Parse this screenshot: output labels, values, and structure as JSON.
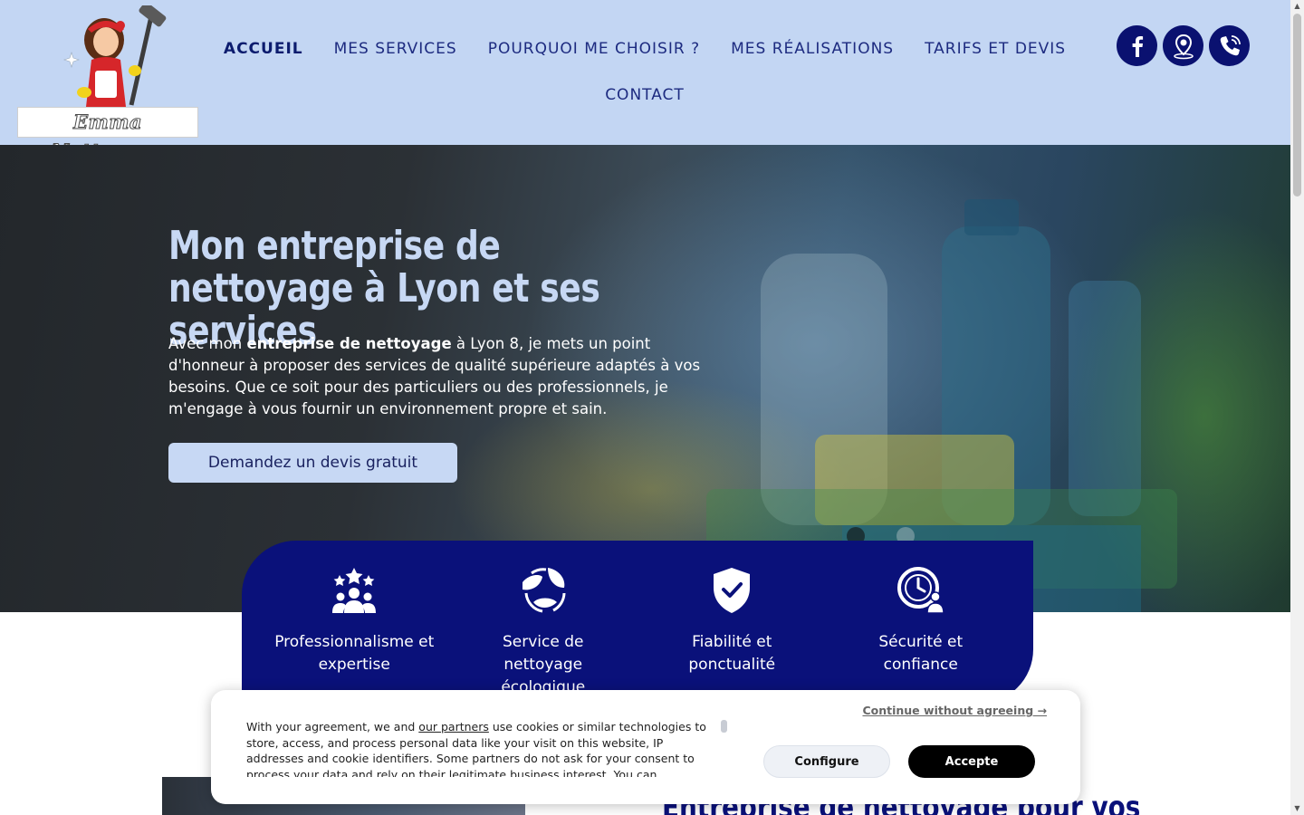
{
  "header": {
    "logo_text": "Emma Nettoyage",
    "nav": {
      "items": [
        {
          "label": "ACCUEIL",
          "active": true
        },
        {
          "label": "MES SERVICES"
        },
        {
          "label": "POURQUOI ME CHOISIR ?"
        },
        {
          "label": "MES RÉALISATIONS"
        },
        {
          "label": "TARIFS ET DEVIS"
        },
        {
          "label": "CONTACT"
        }
      ]
    },
    "socials": [
      {
        "icon": "facebook-icon"
      },
      {
        "icon": "map-pin-icon"
      },
      {
        "icon": "phone-icon"
      }
    ]
  },
  "hero": {
    "title": "Mon entreprise de nettoyage à Lyon et ses services",
    "text_before": "Avec mon ",
    "text_bold": "entreprise de nettoyage",
    "text_after": " à Lyon 8, je mets un point d'honneur à proposer des services de qualité supérieure adaptés à vos besoins. Que ce soit pour des particuliers ou des professionnels, je m'engage à vous fournir un environnement propre et sain.",
    "cta_label": "Demandez un devis gratuit"
  },
  "features": [
    {
      "icon": "team-stars-icon",
      "label": "Professionnalisme et expertise"
    },
    {
      "icon": "eco-leaf-icon",
      "label": "Service de nettoyage écologique"
    },
    {
      "icon": "shield-check-icon",
      "label": "Fiabilité et ponctualité"
    },
    {
      "icon": "clock-user-icon",
      "label": "Sécurité et confiance"
    }
  ],
  "lower": {
    "title": "Entreprise de nettoyage pour vos"
  },
  "cookie": {
    "text_before": "With your agreement, we and ",
    "link": "our partners",
    "text_after": " use cookies or similar technologies to store, access, and process personal data like your visit on this website, IP addresses and cookie identifiers. Some partners do not ask for your consent to process your data and rely on their legitimate business interest. You can",
    "continue": "Continue without agreeing →",
    "configure": "Configure",
    "accept": "Accepte"
  },
  "colors": {
    "header_bg": "#c3d6f3",
    "navy": "#0a117a",
    "hero_title": "#c7d8f4"
  }
}
